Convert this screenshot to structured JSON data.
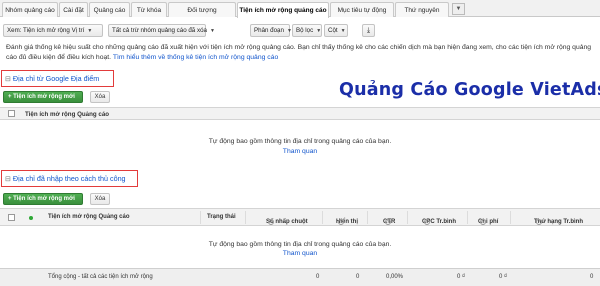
{
  "tabs": [
    {
      "label": "Nhóm quảng cáo",
      "active": false
    },
    {
      "label": "Cài đặt",
      "active": false
    },
    {
      "label": "Quảng cáo",
      "active": false
    },
    {
      "label": "Từ khóa",
      "active": false
    },
    {
      "label": "Đối tượng",
      "active": false
    },
    {
      "label": "Tiện ích mở rộng quảng cáo",
      "active": true
    },
    {
      "label": "Mục tiêu tự động",
      "active": false
    },
    {
      "label": "Thứ nguyên",
      "active": false
    }
  ],
  "toolbar": {
    "view": "Xem: Tiện ích mở rộng Vị trí",
    "filter": "Tất cả trừ nhóm quảng cáo đã xóa",
    "segment": "Phân đoạn",
    "filter_btn": "Bộ lọc",
    "columns": "Cột",
    "download_icon": "download-icon"
  },
  "description": {
    "text": "Đánh giá thống kê hiệu suất cho những quảng cáo đã xuất hiện với tiện ích mở rộng quảng cáo. Bạn chỉ thấy thống kê cho các chiến dịch mà bạn hiện đang xem, cho các tiện ích mở rộng quảng cáo đủ điều kiện để điều kích hoạt.",
    "link": "Tìm hiểu thêm về thống kê tiện ích mở rộng quảng cáo"
  },
  "watermark": "Quảng Cáo Google VietAds",
  "section1": {
    "title": "Địa chỉ từ Google Địa điểm",
    "add_button": "+ Tiện ích mở rộng mới",
    "delete_button": "Xóa",
    "column": "Tiện ích mở rộng Quảng cáo",
    "empty_message": "Tự động bao gồm thông tin địa chỉ trong quảng cáo của bạn.",
    "empty_link": "Tham quan"
  },
  "section2": {
    "title": "Địa chỉ đã nhập theo cách thủ công",
    "add_button": "+ Tiện ích mở rộng mới",
    "delete_button": "Xóa",
    "columns": {
      "ext": "Tiện ích mở rộng Quảng cáo",
      "status": "Trạng thái",
      "clicks": "Số nhấp chuột",
      "impressions": "Hiển thị",
      "ctr": "CTR",
      "cpc": "CPC Tr.bình",
      "cost": "Chi phí",
      "rank": "Thứ hạng Tr.bình"
    },
    "empty_message": "Tự động bao gồm thông tin địa chỉ trong quảng cáo của bạn.",
    "empty_link": "Tham quan"
  },
  "totals": {
    "label": "Tổng cộng - tất cả các tiện ích mở rộng",
    "clicks": "0",
    "impressions": "0",
    "ctr": "0,00%",
    "cpc": "0 ₫",
    "cost": "0 ₫",
    "rank": "0"
  }
}
